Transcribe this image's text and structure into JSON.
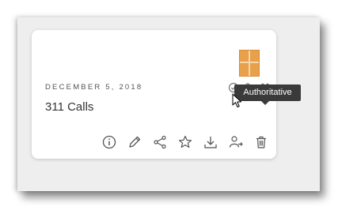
{
  "item": {
    "date": "DECEMBER 5, 2018",
    "title": "311 Calls",
    "tooltip": "Authoritative"
  },
  "badges": [
    {
      "icon": "check-circle-icon"
    },
    {
      "icon": "edit-access-icon"
    },
    {
      "icon": "shared-group-icon"
    }
  ],
  "actions": [
    {
      "icon": "info-icon"
    },
    {
      "icon": "pencil-icon"
    },
    {
      "icon": "share-icon"
    },
    {
      "icon": "star-icon"
    },
    {
      "icon": "download-icon"
    },
    {
      "icon": "change-owner-icon"
    },
    {
      "icon": "trash-icon"
    }
  ],
  "colors": {
    "thumbnail": "#e8a04a",
    "tooltip_bg": "#3a3a3a",
    "icon": "#555555"
  }
}
